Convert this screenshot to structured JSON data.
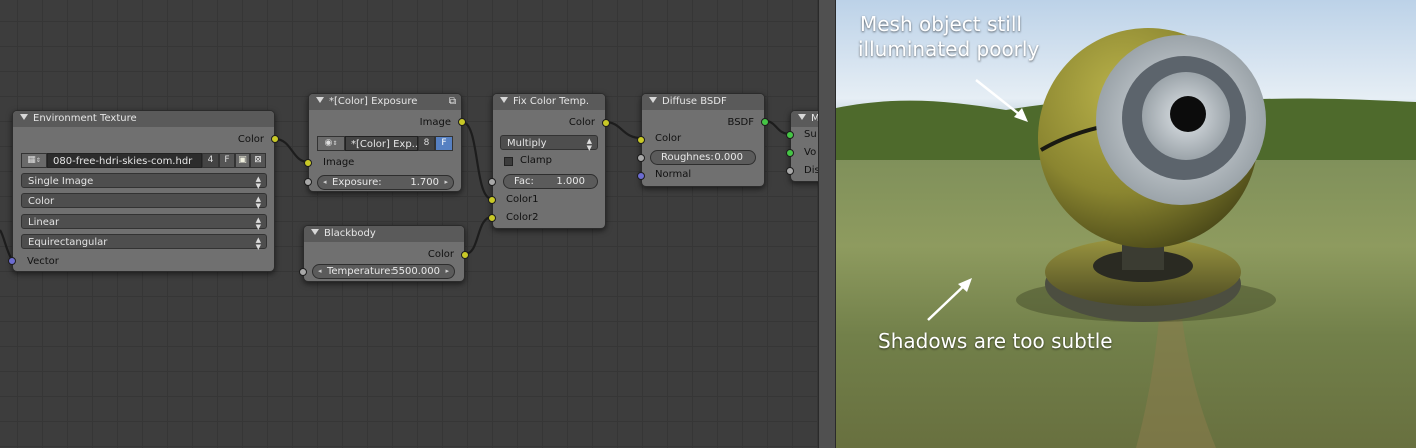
{
  "node_editor": {
    "environment_texture": {
      "title": "Environment Texture",
      "output_color": "Color",
      "image_name": "080-free-hdri-skies-com.hdr",
      "image_users": "4",
      "fake_user": "F",
      "source": "Single Image",
      "color_space": "Color",
      "interpolation": "Linear",
      "projection": "Equirectangular",
      "input_vector": "Vector"
    },
    "exposure": {
      "title": "*[Color] Exposure",
      "output_image": "Image",
      "group_name": "*[Color] Exp...",
      "group_users": "8",
      "fake_user": "F",
      "input_image": "Image",
      "exposure_label": "Exposure:",
      "exposure_value": "1.700"
    },
    "blackbody": {
      "title": "Blackbody",
      "output_color": "Color",
      "temperature_label": "Temperature:",
      "temperature_value": "5500.000"
    },
    "mix": {
      "title": "Fix Color Temp.",
      "output_color": "Color",
      "blend_mode": "Multiply",
      "clamp_label": "Clamp",
      "fac_label": "Fac:",
      "fac_value": "1.000",
      "input_color1": "Color1",
      "input_color2": "Color2"
    },
    "diffuse": {
      "title": "Diffuse BSDF",
      "output_bsdf": "BSDF",
      "input_color": "Color",
      "roughness_label": "Roughnes:",
      "roughness_value": "0.000",
      "input_normal": "Normal"
    },
    "output": {
      "title_partial": "M",
      "input_surface": "Su",
      "input_volume": "Vo",
      "input_displacement": "Dis"
    }
  },
  "render_preview": {
    "annotation_top_line1": "Mesh object still",
    "annotation_top_line2": "illuminated poorly",
    "annotation_bottom": "Shadows are too subtle"
  },
  "colors": {
    "socket_color": "#c9c927",
    "socket_value": "#a8a8a8",
    "socket_vector": "#6c6cd0",
    "socket_shader": "#45c545",
    "node_body": "#707070",
    "grid_background": "#3d3d3d"
  }
}
